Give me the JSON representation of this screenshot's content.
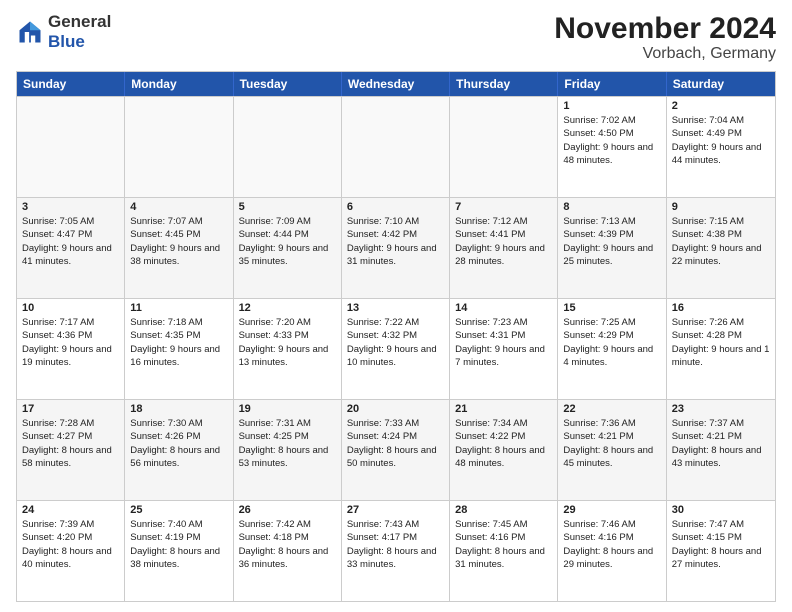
{
  "logo": {
    "general": "General",
    "blue": "Blue"
  },
  "title": "November 2024",
  "subtitle": "Vorbach, Germany",
  "weekdays": [
    "Sunday",
    "Monday",
    "Tuesday",
    "Wednesday",
    "Thursday",
    "Friday",
    "Saturday"
  ],
  "weeks": [
    [
      {
        "day": "",
        "info": ""
      },
      {
        "day": "",
        "info": ""
      },
      {
        "day": "",
        "info": ""
      },
      {
        "day": "",
        "info": ""
      },
      {
        "day": "",
        "info": ""
      },
      {
        "day": "1",
        "info": "Sunrise: 7:02 AM\nSunset: 4:50 PM\nDaylight: 9 hours and 48 minutes."
      },
      {
        "day": "2",
        "info": "Sunrise: 7:04 AM\nSunset: 4:49 PM\nDaylight: 9 hours and 44 minutes."
      }
    ],
    [
      {
        "day": "3",
        "info": "Sunrise: 7:05 AM\nSunset: 4:47 PM\nDaylight: 9 hours and 41 minutes."
      },
      {
        "day": "4",
        "info": "Sunrise: 7:07 AM\nSunset: 4:45 PM\nDaylight: 9 hours and 38 minutes."
      },
      {
        "day": "5",
        "info": "Sunrise: 7:09 AM\nSunset: 4:44 PM\nDaylight: 9 hours and 35 minutes."
      },
      {
        "day": "6",
        "info": "Sunrise: 7:10 AM\nSunset: 4:42 PM\nDaylight: 9 hours and 31 minutes."
      },
      {
        "day": "7",
        "info": "Sunrise: 7:12 AM\nSunset: 4:41 PM\nDaylight: 9 hours and 28 minutes."
      },
      {
        "day": "8",
        "info": "Sunrise: 7:13 AM\nSunset: 4:39 PM\nDaylight: 9 hours and 25 minutes."
      },
      {
        "day": "9",
        "info": "Sunrise: 7:15 AM\nSunset: 4:38 PM\nDaylight: 9 hours and 22 minutes."
      }
    ],
    [
      {
        "day": "10",
        "info": "Sunrise: 7:17 AM\nSunset: 4:36 PM\nDaylight: 9 hours and 19 minutes."
      },
      {
        "day": "11",
        "info": "Sunrise: 7:18 AM\nSunset: 4:35 PM\nDaylight: 9 hours and 16 minutes."
      },
      {
        "day": "12",
        "info": "Sunrise: 7:20 AM\nSunset: 4:33 PM\nDaylight: 9 hours and 13 minutes."
      },
      {
        "day": "13",
        "info": "Sunrise: 7:22 AM\nSunset: 4:32 PM\nDaylight: 9 hours and 10 minutes."
      },
      {
        "day": "14",
        "info": "Sunrise: 7:23 AM\nSunset: 4:31 PM\nDaylight: 9 hours and 7 minutes."
      },
      {
        "day": "15",
        "info": "Sunrise: 7:25 AM\nSunset: 4:29 PM\nDaylight: 9 hours and 4 minutes."
      },
      {
        "day": "16",
        "info": "Sunrise: 7:26 AM\nSunset: 4:28 PM\nDaylight: 9 hours and 1 minute."
      }
    ],
    [
      {
        "day": "17",
        "info": "Sunrise: 7:28 AM\nSunset: 4:27 PM\nDaylight: 8 hours and 58 minutes."
      },
      {
        "day": "18",
        "info": "Sunrise: 7:30 AM\nSunset: 4:26 PM\nDaylight: 8 hours and 56 minutes."
      },
      {
        "day": "19",
        "info": "Sunrise: 7:31 AM\nSunset: 4:25 PM\nDaylight: 8 hours and 53 minutes."
      },
      {
        "day": "20",
        "info": "Sunrise: 7:33 AM\nSunset: 4:24 PM\nDaylight: 8 hours and 50 minutes."
      },
      {
        "day": "21",
        "info": "Sunrise: 7:34 AM\nSunset: 4:22 PM\nDaylight: 8 hours and 48 minutes."
      },
      {
        "day": "22",
        "info": "Sunrise: 7:36 AM\nSunset: 4:21 PM\nDaylight: 8 hours and 45 minutes."
      },
      {
        "day": "23",
        "info": "Sunrise: 7:37 AM\nSunset: 4:21 PM\nDaylight: 8 hours and 43 minutes."
      }
    ],
    [
      {
        "day": "24",
        "info": "Sunrise: 7:39 AM\nSunset: 4:20 PM\nDaylight: 8 hours and 40 minutes."
      },
      {
        "day": "25",
        "info": "Sunrise: 7:40 AM\nSunset: 4:19 PM\nDaylight: 8 hours and 38 minutes."
      },
      {
        "day": "26",
        "info": "Sunrise: 7:42 AM\nSunset: 4:18 PM\nDaylight: 8 hours and 36 minutes."
      },
      {
        "day": "27",
        "info": "Sunrise: 7:43 AM\nSunset: 4:17 PM\nDaylight: 8 hours and 33 minutes."
      },
      {
        "day": "28",
        "info": "Sunrise: 7:45 AM\nSunset: 4:16 PM\nDaylight: 8 hours and 31 minutes."
      },
      {
        "day": "29",
        "info": "Sunrise: 7:46 AM\nSunset: 4:16 PM\nDaylight: 8 hours and 29 minutes."
      },
      {
        "day": "30",
        "info": "Sunrise: 7:47 AM\nSunset: 4:15 PM\nDaylight: 8 hours and 27 minutes."
      }
    ]
  ]
}
